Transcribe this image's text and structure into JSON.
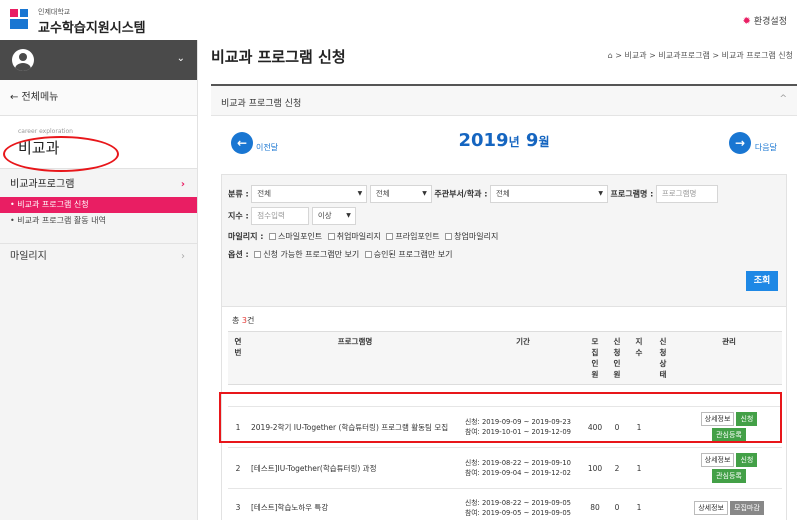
{
  "header": {
    "university": "인제대학교",
    "system_name": "교수학습지원시스템",
    "settings_label": "환경설정",
    "settings_icon": "gear-icon",
    "accent_color": "#e91e63"
  },
  "sidebar": {
    "all_menu_label": "← 전체메뉴",
    "category_eng": "career exploration",
    "category_kor": "비교과",
    "menu_group": "비교과프로그램",
    "items": [
      {
        "label": "• 비교과 프로그램 신청",
        "active": true
      },
      {
        "label": "• 비교과 프로그램 활동 내역",
        "active": false
      }
    ],
    "menu_group2": "마일리지"
  },
  "main": {
    "title": "비교과 프로그램 신청",
    "breadcrumb": "> 비교과 > 비교과프로그램 > 비교과 프로그램 신청",
    "box_title": "비교과 프로그램 신청",
    "collapse_icon": "chevron-up-icon",
    "calendar": {
      "year": "2019",
      "year_suffix": "년",
      "month": "9",
      "month_suffix": "월",
      "prev_label": "이전달",
      "next_label": "다음달"
    }
  },
  "filter": {
    "category_label": "분류 :",
    "category_value": "전체",
    "category2_value": "전체",
    "dept_label": "주관부서/학과 :",
    "dept_value": "전체",
    "program_label": "프로그램명 :",
    "program_placeholder": "프로그램명",
    "index_label": "지수 :",
    "index_placeholder": "점수입력",
    "index_op": "이상",
    "mileage_label": "마일리지 :",
    "mileage_options": [
      "스마일포인트",
      "취업마일리지",
      "프라임포인트",
      "창업마일리지"
    ],
    "option_label": "옵션 :",
    "option_items": [
      "신청 가능한 프로그램만 보기",
      "승인된 프로그램만 보기"
    ],
    "search_label": "조회"
  },
  "table": {
    "total_prefix": "총 ",
    "total_count": "3",
    "total_suffix": "건",
    "headers": {
      "no": "연\n번",
      "name": "프로그램명",
      "period": "기간",
      "recruit": "모\n집\n인\n원",
      "applied": "신\n청\n인\n원",
      "index": "지\n수",
      "status": "신\n청\n상\n태",
      "manage": "관리"
    },
    "rows": [
      {
        "no": "1",
        "name": "2019-2학기 IU-Together (학습튜터링) 프로그램 활동팀 모집",
        "apply_period": "신청: 2019-09-09 ~ 2019-09-23",
        "join_period": "참여: 2019-10-01 ~ 2019-12-09",
        "recruit": "400",
        "applied": "0",
        "index": "1",
        "status": "",
        "btn_detail": "상세정보",
        "btn_apply": "신청",
        "btn_interest": "관심등록"
      },
      {
        "no": "2",
        "name": "[테스트]IU-Together(학습튜터링) 과정",
        "apply_period": "신청: 2019-08-22 ~ 2019-09-10",
        "join_period": "참여: 2019-09-04 ~ 2019-12-02",
        "recruit": "100",
        "applied": "2",
        "index": "1",
        "status": "",
        "btn_detail": "상세정보",
        "btn_apply": "신청",
        "btn_interest": "관심등록"
      },
      {
        "no": "3",
        "name": "[테스트]학습노하우 특강",
        "apply_period": "신청: 2019-08-22 ~ 2019-09-05",
        "join_period": "참여: 2019-09-05 ~ 2019-09-05",
        "recruit": "80",
        "applied": "0",
        "index": "1",
        "status": "",
        "btn_detail": "상세정보",
        "btn_closed": "모집마감"
      }
    ]
  }
}
